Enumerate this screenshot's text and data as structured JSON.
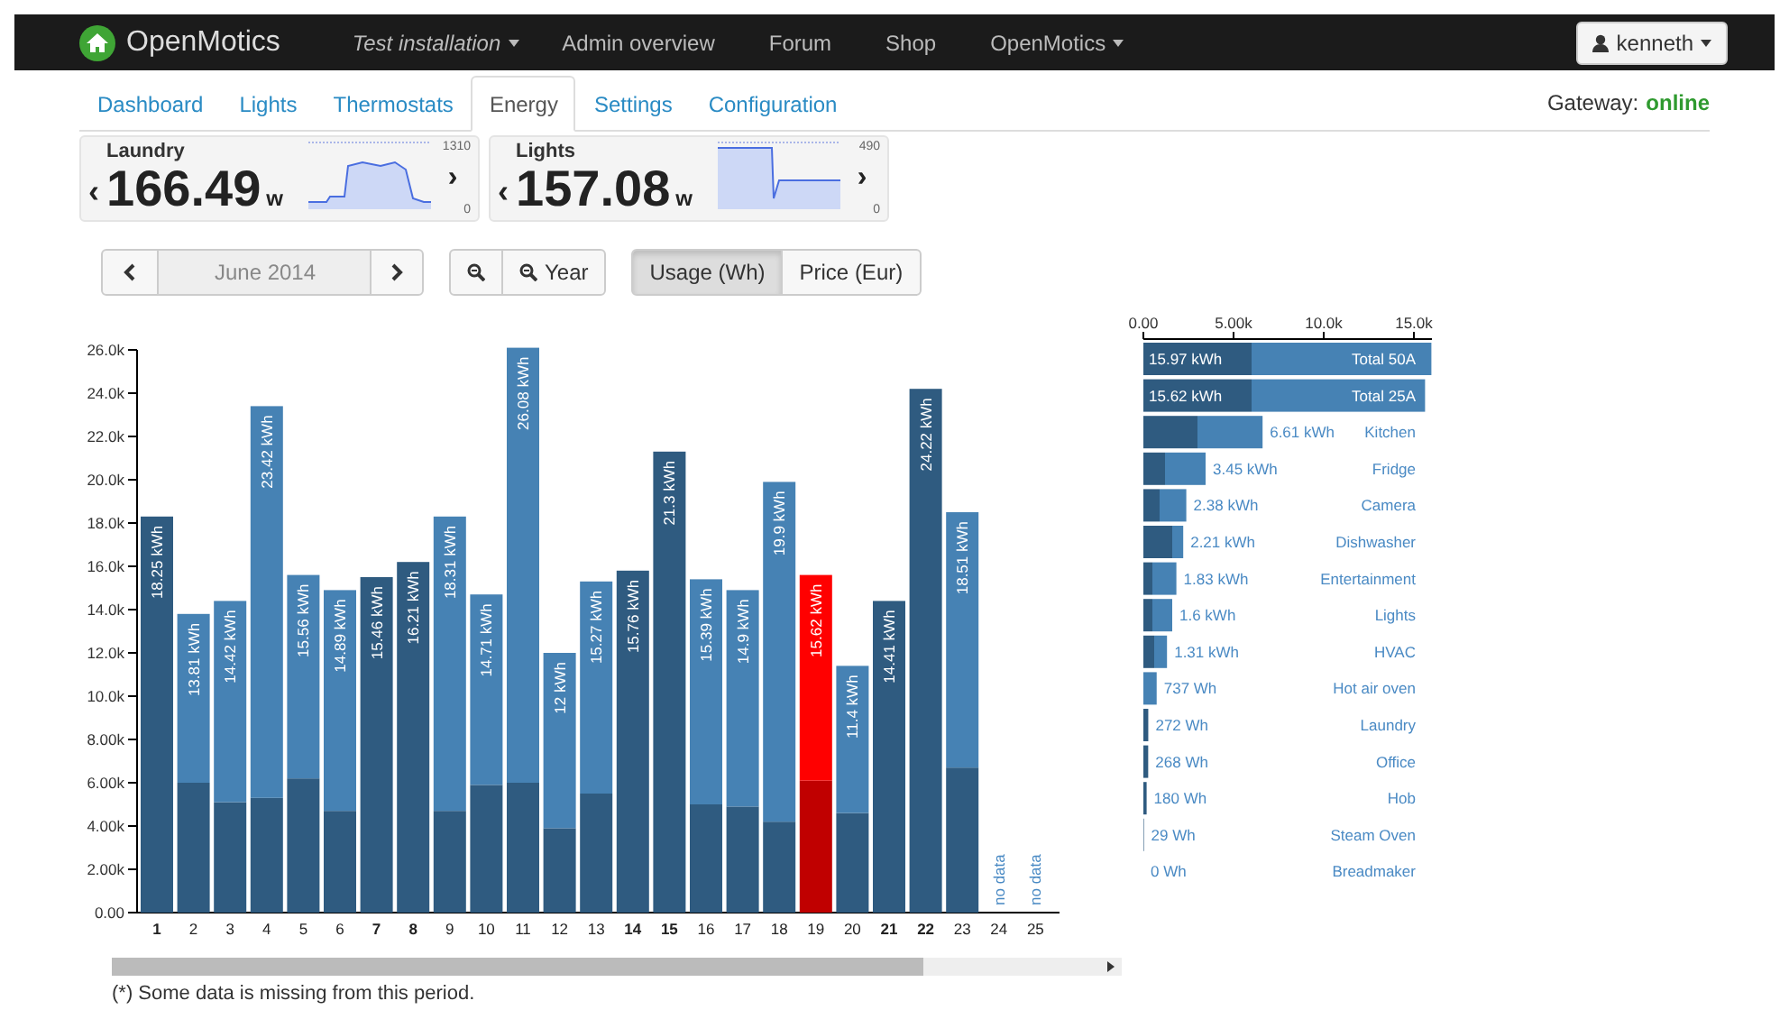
{
  "navbar": {
    "brand": "OpenMotics",
    "items": [
      {
        "label": "Test installation",
        "dropdown": true,
        "italic": true
      },
      {
        "label": "Admin overview",
        "dropdown": false,
        "italic": false
      },
      {
        "label": "Forum",
        "dropdown": false,
        "italic": false
      },
      {
        "label": "Shop",
        "dropdown": false,
        "italic": false
      },
      {
        "label": "OpenMotics",
        "dropdown": true,
        "italic": false
      }
    ],
    "user": "kenneth"
  },
  "tabs": [
    {
      "label": "Dashboard",
      "selected": false
    },
    {
      "label": "Lights",
      "selected": false
    },
    {
      "label": "Thermostats",
      "selected": false
    },
    {
      "label": "Energy",
      "selected": true
    },
    {
      "label": "Settings",
      "selected": false
    },
    {
      "label": "Configuration",
      "selected": false
    }
  ],
  "gateway": {
    "label": "Gateway:",
    "status": "online"
  },
  "widgets": [
    {
      "name": "Laundry",
      "value": "166.49",
      "unit": "w",
      "max": "1310",
      "min": "0",
      "prev": "‹",
      "next": "›",
      "kind": "plateau"
    },
    {
      "name": "Lights",
      "value": "157.08",
      "unit": "w",
      "max": "490",
      "min": "0",
      "prev": "‹",
      "next": "›",
      "kind": "drop"
    }
  ],
  "controls": {
    "period": "June 2014",
    "zoom_label": "Year",
    "modes": [
      {
        "label": "Usage (Wh)",
        "selected": true
      },
      {
        "label": "Price (Eur)",
        "selected": false
      }
    ]
  },
  "main_chart": {
    "days": [
      {
        "bold": true
      },
      {
        "bold": false
      },
      {
        "bold": false
      },
      {
        "bold": false
      },
      {
        "bold": false
      },
      {
        "bold": false
      },
      {
        "bold": true
      },
      {
        "bold": true
      },
      {
        "bold": false
      },
      {
        "bold": false
      },
      {
        "bold": false
      },
      {
        "bold": false
      },
      {
        "bold": false
      },
      {
        "bold": true
      },
      {
        "bold": true
      },
      {
        "bold": false
      },
      {
        "bold": false
      },
      {
        "bold": false
      },
      {
        "bold": false
      },
      {
        "bold": false
      },
      {
        "bold": true
      },
      {
        "bold": true
      },
      {
        "bold": false
      },
      {
        "bold": false
      },
      {
        "bold": false
      }
    ],
    "chart_data": {
      "type": "bar",
      "stacked": true,
      "categories": [
        "1",
        "2",
        "3",
        "4",
        "5",
        "6",
        "7",
        "8",
        "9",
        "10",
        "11",
        "12",
        "13",
        "14",
        "15",
        "16",
        "17",
        "18",
        "19",
        "20",
        "21",
        "22",
        "23",
        "24",
        "25"
      ],
      "series": [
        {
          "color": "#2f5b80",
          "values": [
            18300,
            6000,
            5100,
            5300,
            6200,
            4700,
            15500,
            16200,
            4700,
            5900,
            6000,
            3900,
            5500,
            15800,
            21300,
            5000,
            4900,
            4200,
            null,
            4600,
            14400,
            24200,
            6700,
            null,
            null
          ]
        },
        {
          "color": "#4682b4",
          "values": [
            0,
            7800,
            9300,
            18100,
            9400,
            10200,
            0,
            0,
            13600,
            8800,
            20100,
            8100,
            9800,
            0,
            0,
            10400,
            10000,
            15700,
            null,
            6800,
            0,
            0,
            11800,
            null,
            null
          ]
        },
        {
          "color": "#c00000",
          "values": [
            null,
            null,
            null,
            null,
            null,
            null,
            null,
            null,
            null,
            null,
            null,
            null,
            null,
            null,
            null,
            null,
            null,
            null,
            6100,
            null,
            null,
            null,
            null,
            null,
            null
          ]
        },
        {
          "color": "#ff0000",
          "values": [
            null,
            null,
            null,
            null,
            null,
            null,
            null,
            null,
            null,
            null,
            null,
            null,
            null,
            null,
            null,
            null,
            null,
            null,
            9500,
            null,
            null,
            null,
            null,
            null,
            null
          ]
        }
      ],
      "ylim": [
        0,
        26000
      ],
      "yticks": [
        {
          "value": 0,
          "label": "0.00"
        },
        {
          "value": 2000,
          "label": "2.00k"
        },
        {
          "value": 4000,
          "label": "4.00k"
        },
        {
          "value": 6000,
          "label": "6.00k"
        },
        {
          "value": 8000,
          "label": "8.00k"
        },
        {
          "value": 10000,
          "label": "10.0k"
        },
        {
          "value": 12000,
          "label": "12.0k"
        },
        {
          "value": 14000,
          "label": "14.0k"
        },
        {
          "value": 16000,
          "label": "16.0k"
        },
        {
          "value": 18000,
          "label": "18.0k"
        },
        {
          "value": 20000,
          "label": "20.0k"
        },
        {
          "value": 22000,
          "label": "22.0k"
        },
        {
          "value": 24000,
          "label": "24.0k"
        },
        {
          "value": 26000,
          "label": "26.0k"
        }
      ],
      "value_labels": [
        "18.25 kWh",
        "13.81 kWh",
        "14.42 kWh",
        "23.42 kWh",
        "15.56 kWh",
        "14.89 kWh",
        "15.46 kWh",
        "16.21 kWh",
        "18.31 kWh",
        "14.71 kWh",
        "26.08 kWh",
        "12 kWh",
        "15.27 kWh",
        "15.76 kWh",
        "21.3 kWh",
        "15.39 kWh",
        "14.9 kWh",
        "19.9 kWh",
        "15.62 kWh",
        "11.4 kWh",
        "14.41 kWh",
        "24.22 kWh",
        "18.51 kWh",
        "no data",
        "no data"
      ]
    }
  },
  "side_chart": {
    "chart_data": {
      "type": "bar",
      "orientation": "horizontal",
      "stacked": true,
      "categories": [
        "Total 50A",
        "Total 25A",
        "Kitchen",
        "Fridge",
        "Camera",
        "Dishwasher",
        "Entertainment",
        "Lights",
        "HVAC",
        "Hot air oven",
        "Laundry",
        "Office",
        "Hob",
        "Steam Oven",
        "Breadmaker"
      ],
      "series": [
        {
          "color": "#2f5b80",
          "values": [
            6000,
            6000,
            3000,
            1200,
            900,
            1600,
            500,
            500,
            600,
            0,
            272,
            268,
            180,
            29,
            0
          ]
        },
        {
          "color": "#4682b4",
          "values": [
            9970,
            9620,
            3610,
            2250,
            1480,
            610,
            1330,
            1100,
            710,
            737,
            0,
            0,
            0,
            0,
            0
          ]
        }
      ],
      "xlim": [
        0,
        16000
      ],
      "xticks": [
        {
          "value": 0,
          "label": "0.00"
        },
        {
          "value": 5000,
          "label": "5.00k"
        },
        {
          "value": 10000,
          "label": "10.0k"
        },
        {
          "value": 15000,
          "label": "15.0k"
        }
      ],
      "value_labels": [
        "15.97 kWh",
        "15.62 kWh",
        "6.61 kWh",
        "3.45 kWh",
        "2.38 kWh",
        "2.21 kWh",
        "1.83 kWh",
        "1.6 kWh",
        "1.31 kWh",
        "737 Wh",
        "272 Wh",
        "268 Wh",
        "180 Wh",
        "29 Wh",
        "0 Wh"
      ]
    }
  },
  "footnote": "(*) Some data is missing from this period."
}
